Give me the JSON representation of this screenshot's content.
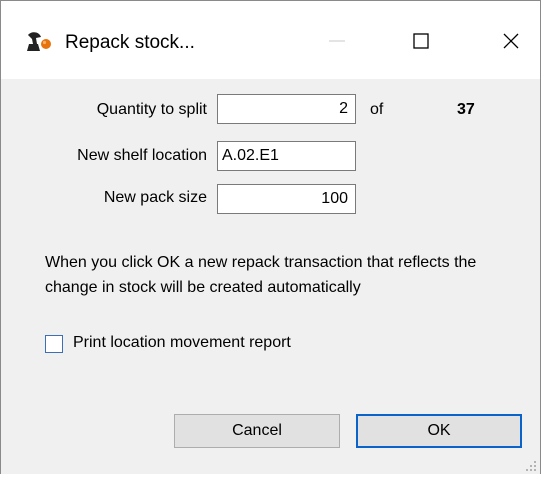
{
  "window": {
    "title": "Repack stock...",
    "icon": "mushroom-app-icon",
    "controls": {
      "minimize": "minimize-icon",
      "maximize": "maximize-icon",
      "close": "close-icon"
    }
  },
  "form": {
    "quantity_label": "Quantity to split",
    "quantity_value": "2",
    "of_label": "of",
    "total_quantity": "37",
    "shelf_label": "New shelf location",
    "shelf_value": "A.02.E1",
    "pack_size_label": "New pack size",
    "pack_size_value": "100"
  },
  "info_text": "When you click OK a new repack transaction that reflects the change in stock will be created automatically",
  "checkbox": {
    "label": "Print location movement report",
    "checked": false
  },
  "buttons": {
    "cancel_label": "Cancel",
    "ok_label": "OK"
  },
  "colors": {
    "accent": "#0a63c9",
    "checkbox_border": "#3c6fb8",
    "dialog_background": "#f0f0f0",
    "button_background": "#e1e1e1"
  }
}
